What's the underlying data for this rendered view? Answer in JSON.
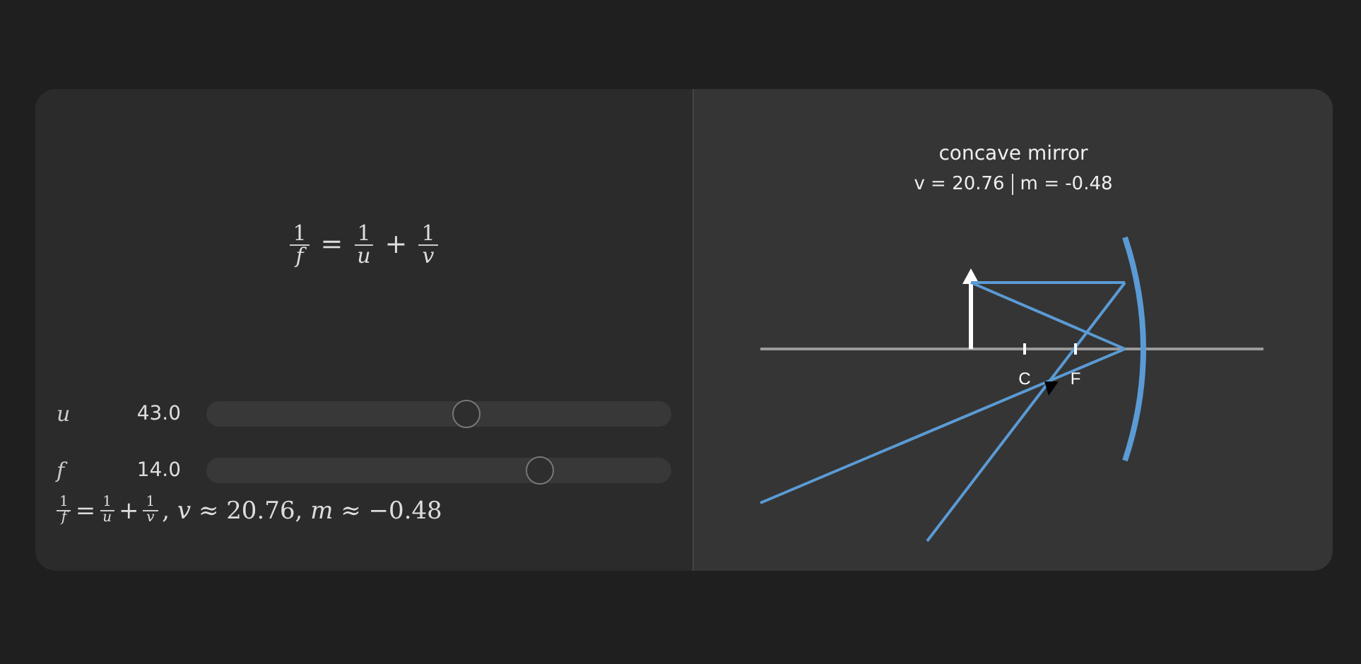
{
  "formula": [
    {
      "kind": "frac",
      "num": "1",
      "den": "f"
    },
    {
      "kind": "op",
      "text": "="
    },
    {
      "kind": "frac",
      "num": "1",
      "den": "u"
    },
    {
      "kind": "op",
      "text": "+"
    },
    {
      "kind": "frac",
      "num": "1",
      "den": "v"
    }
  ],
  "sliders": [
    {
      "symbol": "u",
      "value": "43.0",
      "level": 0.56
    },
    {
      "symbol": "f",
      "value": "14.0",
      "level": 0.716
    }
  ],
  "summary": {
    "formula": [
      {
        "kind": "frac",
        "num": "1",
        "den": "f"
      },
      {
        "kind": "op",
        "text": "="
      },
      {
        "kind": "frac",
        "num": "1",
        "den": "u"
      },
      {
        "kind": "op",
        "text": "+"
      },
      {
        "kind": "frac",
        "num": "1",
        "den": "v"
      }
    ],
    "result": ", *v* ≈ 20.76, *m* ≈ −0.48"
  },
  "diagram": {
    "title": "concave mirror",
    "readouts": [
      "v = 20.76",
      "m = -0.48"
    ],
    "points": [
      "C",
      "F"
    ]
  }
}
